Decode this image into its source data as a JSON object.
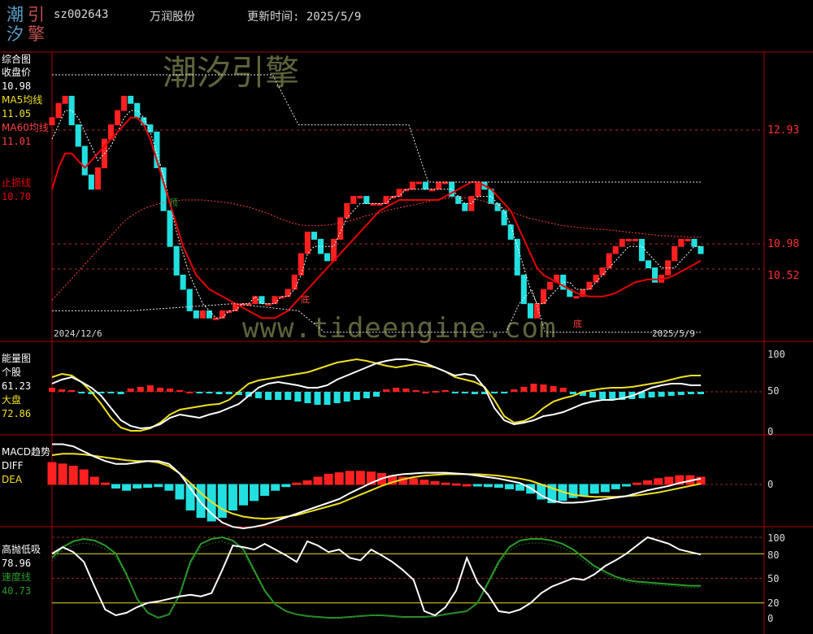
{
  "header": {
    "logo_chars": [
      "潮",
      "引",
      "汐",
      "擎"
    ],
    "stock_code": "sz002643",
    "stock_name": "万润股份",
    "update_time": "更新时间: 2025/5/9"
  },
  "watermarks": {
    "cn": "潮汐引擎",
    "url": "www.tideengine.com"
  },
  "colors": {
    "background": "#000000",
    "border": "#b00000",
    "rise": "#ff2020",
    "fall": "#22e0e0",
    "ma5": "#ffffff",
    "ma60": "#ff4040",
    "stop": "#e80000",
    "yellow": "#f0e020",
    "speed": "#2a9a2a"
  },
  "panels": {
    "main": {
      "title": "综合图",
      "close_label": "收盘价",
      "close_value": "10.98",
      "ma5_label": "MA5均线",
      "ma5_value": "11.05",
      "ma60_label": "MA60均线",
      "ma60_value": "11.01",
      "stop_label": "止损线",
      "stop_value": "10.70",
      "start_date": "2024/12/6",
      "end_date": "2025/5/9",
      "ticks": [
        "12.93",
        "10.98",
        "10.52"
      ],
      "marks": [
        "顶",
        "底",
        "底"
      ]
    },
    "energy": {
      "title": "能量图",
      "stock_label": "个股",
      "stock_value": "61.23",
      "market_label": "大盘",
      "market_value": "72.86",
      "ticks": [
        "100",
        "50",
        "0"
      ]
    },
    "macd": {
      "title": "MACD趋势",
      "diff_label": "DIFF",
      "dea_label": "DEA",
      "ticks": [
        "0"
      ]
    },
    "sell": {
      "title": "高抛低吸",
      "value": "78.96",
      "speed_label": "速度线",
      "speed_value": "40.73",
      "ticks": [
        "100",
        "80",
        "50",
        "20",
        "0"
      ]
    }
  },
  "chart_data": {
    "type": "candlestick",
    "title": "",
    "x_range": [
      "2024/12/6",
      "2025/5/9"
    ],
    "count": 100,
    "y_range": [
      10.1,
      13.6
    ],
    "close": [
      13.0,
      13.2,
      13.3,
      12.9,
      12.6,
      12.2,
      12.0,
      12.3,
      12.7,
      12.9,
      13.1,
      13.3,
      13.2,
      13.0,
      12.9,
      12.8,
      12.3,
      11.7,
      11.2,
      10.8,
      10.6,
      10.3,
      10.2,
      10.3,
      10.2,
      10.2,
      10.3,
      10.3,
      10.4,
      10.4,
      10.4,
      10.5,
      10.4,
      10.4,
      10.5,
      10.5,
      10.6,
      10.8,
      11.1,
      11.4,
      11.3,
      11.1,
      11.0,
      11.3,
      11.6,
      11.8,
      11.9,
      11.9,
      11.8,
      11.8,
      11.8,
      11.9,
      11.9,
      12.0,
      12.0,
      12.1,
      12.1,
      12.0,
      12.0,
      12.1,
      12.1,
      11.9,
      11.8,
      11.7,
      11.9,
      12.1,
      12.0,
      11.8,
      11.7,
      11.5,
      11.3,
      10.8,
      10.4,
      10.2,
      10.4,
      10.6,
      10.7,
      10.8,
      10.6,
      10.5,
      10.5,
      10.6,
      10.7,
      10.8,
      10.9,
      11.1,
      11.2,
      11.3,
      11.3,
      11.3,
      11.0,
      10.9,
      10.7,
      10.8,
      11.0,
      11.2,
      11.3,
      11.3,
      11.2,
      11.1
    ],
    "ma5": [
      12.7,
      12.9,
      13.1,
      13.1,
      13.0,
      12.8,
      12.6,
      12.4,
      12.5,
      12.6,
      12.8,
      13.0,
      13.1,
      13.1,
      13.0,
      12.8,
      12.5,
      12.2,
      11.8,
      11.4,
      11.1,
      10.8,
      10.6,
      10.4,
      10.3,
      10.2,
      10.2,
      10.3,
      10.3,
      10.4,
      10.4,
      10.5,
      10.4,
      10.4,
      10.4,
      10.5,
      10.5,
      10.6,
      10.8,
      11.1,
      11.2,
      11.2,
      11.2,
      11.2,
      11.4,
      11.6,
      11.7,
      11.8,
      11.8,
      11.8,
      11.8,
      11.8,
      11.9,
      11.9,
      12.0,
      12.0,
      12.0,
      12.0,
      12.0,
      12.0,
      12.0,
      12.0,
      11.9,
      11.8,
      11.8,
      11.9,
      11.9,
      11.9,
      11.8,
      11.7,
      11.5,
      11.2,
      10.9,
      10.6,
      10.4,
      10.4,
      10.5,
      10.6,
      10.7,
      10.7,
      10.6,
      10.6,
      10.6,
      10.7,
      10.8,
      10.9,
      11.0,
      11.1,
      11.2,
      11.2,
      11.2,
      11.1,
      11.0,
      10.9,
      10.9,
      10.9,
      11.0,
      11.1,
      11.2,
      11.2
    ],
    "ma60": [
      10.45,
      10.55,
      10.65,
      10.75,
      10.85,
      10.95,
      11.05,
      11.15,
      11.25,
      11.35,
      11.45,
      11.55,
      11.62,
      11.68,
      11.73,
      11.76,
      11.79,
      11.81,
      11.83,
      11.84,
      11.85,
      11.85,
      11.85,
      11.85,
      11.84,
      11.83,
      11.82,
      11.81,
      11.79,
      11.77,
      11.75,
      11.72,
      11.69,
      11.66,
      11.62,
      11.58,
      11.55,
      11.52,
      11.5,
      11.49,
      11.49,
      11.49,
      11.5,
      11.51,
      11.53,
      11.55,
      11.57,
      11.6,
      11.63,
      11.65,
      11.67,
      11.7,
      11.72,
      11.74,
      11.76,
      11.78,
      11.8,
      11.82,
      11.84,
      11.86,
      11.87,
      11.88,
      11.88,
      11.88,
      11.87,
      11.85,
      11.83,
      11.8,
      11.77,
      11.73,
      11.69,
      11.65,
      11.62,
      11.59,
      11.57,
      11.55,
      11.53,
      11.51,
      11.49,
      11.48,
      11.47,
      11.46,
      11.45,
      11.44,
      11.44,
      11.43,
      11.42,
      11.41,
      11.4,
      11.39,
      11.38,
      11.37,
      11.36,
      11.35,
      11.35,
      11.34,
      11.34,
      11.33,
      11.33,
      11.33
    ],
    "stop": [
      12.0,
      12.3,
      12.5,
      12.5,
      12.4,
      12.3,
      12.4,
      12.5,
      12.6,
      12.7,
      12.8,
      12.9,
      13.0,
      13.0,
      12.9,
      12.7,
      12.4,
      12.1,
      11.8,
      11.5,
      11.2,
      11.0,
      10.8,
      10.7,
      10.6,
      10.55,
      10.5,
      10.45,
      10.4,
      10.35,
      10.3,
      10.25,
      10.2,
      10.2,
      10.2,
      10.25,
      10.3,
      10.4,
      10.5,
      10.6,
      10.7,
      10.8,
      10.9,
      11.0,
      11.1,
      11.2,
      11.3,
      11.4,
      11.5,
      11.6,
      11.7,
      11.75,
      11.8,
      11.85,
      11.85,
      11.85,
      11.85,
      11.85,
      11.85,
      11.85,
      11.9,
      11.95,
      12.0,
      12.05,
      12.1,
      12.1,
      12.05,
      12.0,
      11.9,
      11.8,
      11.7,
      11.5,
      11.3,
      11.1,
      10.9,
      10.8,
      10.75,
      10.7,
      10.65,
      10.6,
      10.55,
      10.52,
      10.5,
      10.5,
      10.5,
      10.52,
      10.55,
      10.6,
      10.65,
      10.7,
      10.72,
      10.74,
      10.74,
      10.74,
      10.76,
      10.8,
      10.85,
      10.9,
      10.95,
      11.0
    ],
    "band_upper": [
      13.6,
      13.6,
      13.6,
      13.6,
      13.6,
      13.6,
      13.6,
      13.6,
      13.6,
      13.6,
      13.6,
      13.6,
      13.6,
      13.6,
      13.6,
      13.6,
      13.6,
      13.6,
      13.6,
      13.6,
      13.6,
      13.6,
      13.6,
      13.6,
      13.6,
      13.6,
      13.6,
      13.6,
      13.6,
      13.6,
      13.6,
      13.6,
      13.6,
      13.6,
      13.6,
      13.6,
      13.6,
      13.6,
      13.6,
      13.6,
      13.6,
      13.6,
      13.6,
      13.6,
      13.6,
      13.6,
      13.6,
      13.6,
      13.6,
      13.6,
      13.6,
      13.6,
      13.6,
      13.6,
      13.6,
      13.6,
      13.6,
      13.6,
      13.6,
      13.6,
      13.6,
      13.6,
      13.6,
      13.6,
      13.6,
      13.6,
      13.6,
      13.6,
      13.6,
      13.6,
      13.6,
      13.6,
      13.6,
      13.6,
      13.6,
      13.6,
      13.6,
      13.6,
      13.6,
      13.6,
      13.6,
      13.6,
      13.6,
      13.6,
      13.6,
      13.6,
      13.6,
      13.6,
      13.6,
      13.6,
      13.6,
      13.6,
      13.6,
      13.6,
      13.6,
      13.6,
      13.6,
      13.6,
      13.6,
      13.6
    ],
    "upper_levels": [
      [
        0,
        13.6
      ],
      [
        34,
        13.6
      ],
      [
        38,
        12.9
      ],
      [
        55,
        12.9
      ],
      [
        58,
        12.1
      ],
      [
        80,
        12.1
      ],
      [
        88,
        12.1
      ],
      [
        90,
        12.1
      ],
      [
        100,
        12.1
      ]
    ],
    "lower_levels": [
      [
        0,
        10.3
      ],
      [
        12,
        10.3
      ],
      [
        28,
        10.4
      ],
      [
        38,
        10.3
      ],
      [
        42,
        10.0
      ],
      [
        70,
        10.0
      ],
      [
        72,
        10.4
      ],
      [
        74,
        10.6
      ],
      [
        76,
        10.0
      ],
      [
        100,
        10.0
      ]
    ],
    "energy_stock": [
      60,
      65,
      68,
      62,
      55,
      45,
      30,
      15,
      8,
      5,
      6,
      10,
      18,
      22,
      20,
      18,
      22,
      25,
      30,
      35,
      45,
      55,
      60,
      62,
      60,
      58,
      55,
      55,
      58,
      65,
      70,
      75,
      80,
      85,
      88,
      90,
      90,
      88,
      85,
      80,
      75,
      70,
      72,
      70,
      55,
      30,
      15,
      10,
      12,
      15,
      20,
      22,
      25,
      30,
      35,
      38,
      40,
      40,
      42,
      45,
      50,
      55,
      58,
      60,
      60,
      58,
      58
    ],
    "energy_market": [
      68,
      72,
      70,
      62,
      50,
      35,
      18,
      6,
      2,
      2,
      5,
      12,
      22,
      28,
      30,
      32,
      34,
      35,
      40,
      50,
      60,
      64,
      66,
      68,
      70,
      72,
      74,
      78,
      82,
      86,
      88,
      90,
      88,
      85,
      82,
      80,
      82,
      84,
      82,
      80,
      75,
      68,
      65,
      62,
      56,
      40,
      20,
      12,
      14,
      20,
      30,
      38,
      42,
      45,
      50,
      52,
      54,
      55,
      55,
      56,
      58,
      60,
      62,
      65,
      68,
      70,
      70
    ],
    "energy_bars": [
      5,
      3,
      2,
      -1,
      -3,
      -2,
      -2,
      -3,
      4,
      6,
      8,
      5,
      4,
      2,
      0,
      -1,
      -2,
      -3,
      -3,
      -4,
      -6,
      -8,
      -10,
      -10,
      -10,
      -12,
      -14,
      -16,
      -16,
      -14,
      -12,
      -10,
      -8,
      -6,
      3,
      5,
      4,
      2,
      0,
      1,
      2,
      -1,
      -2,
      -3,
      -3,
      -2,
      -1,
      3,
      6,
      10,
      9,
      7,
      5,
      -3,
      -5,
      -7,
      -9,
      -10,
      -10,
      -9,
      -8,
      -7,
      -6,
      -5,
      -4,
      -3,
      -3
    ],
    "macd_diff": [
      0.55,
      0.55,
      0.52,
      0.45,
      0.38,
      0.32,
      0.28,
      0.28,
      0.3,
      0.32,
      0.32,
      0.28,
      0.15,
      -0.05,
      -0.25,
      -0.4,
      -0.52,
      -0.58,
      -0.6,
      -0.58,
      -0.55,
      -0.5,
      -0.45,
      -0.4,
      -0.35,
      -0.3,
      -0.25,
      -0.2,
      -0.12,
      -0.05,
      0.02,
      0.08,
      0.12,
      0.14,
      0.15,
      0.16,
      0.16,
      0.16,
      0.15,
      0.14,
      0.12,
      0.1,
      0.08,
      0.05,
      0.02,
      -0.05,
      -0.15,
      -0.22,
      -0.25,
      -0.25,
      -0.24,
      -0.22,
      -0.2,
      -0.18,
      -0.16,
      -0.12,
      -0.08,
      -0.05,
      -0.02,
      0.02,
      0.05,
      0.08
    ],
    "macd_dea": [
      0.4,
      0.42,
      0.42,
      0.41,
      0.39,
      0.37,
      0.35,
      0.33,
      0.32,
      0.32,
      0.3,
      0.25,
      0.15,
      0.02,
      -0.12,
      -0.24,
      -0.34,
      -0.4,
      -0.44,
      -0.46,
      -0.47,
      -0.46,
      -0.44,
      -0.42,
      -0.38,
      -0.34,
      -0.3,
      -0.26,
      -0.2,
      -0.14,
      -0.08,
      -0.02,
      0.03,
      0.07,
      0.1,
      0.12,
      0.13,
      0.14,
      0.14,
      0.14,
      0.14,
      0.13,
      0.12,
      0.1,
      0.08,
      0.05,
      0.0,
      -0.05,
      -0.1,
      -0.14,
      -0.16,
      -0.17,
      -0.17,
      -0.17,
      -0.16,
      -0.15,
      -0.13,
      -0.11,
      -0.08,
      -0.05,
      -0.02,
      0.01
    ],
    "macd_bars": [
      0.3,
      0.28,
      0.25,
      0.2,
      0.1,
      0.02,
      -0.05,
      -0.08,
      -0.05,
      -0.04,
      -0.03,
      -0.08,
      -0.2,
      -0.35,
      -0.45,
      -0.5,
      -0.45,
      -0.35,
      -0.28,
      -0.22,
      -0.15,
      -0.08,
      -0.03,
      0.02,
      0.05,
      0.1,
      0.14,
      0.16,
      0.18,
      0.18,
      0.17,
      0.15,
      0.12,
      0.1,
      0.08,
      0.06,
      0.04,
      0.02,
      0.01,
      0.0,
      -0.02,
      -0.03,
      -0.04,
      -0.06,
      -0.08,
      -0.12,
      -0.2,
      -0.25,
      -0.22,
      -0.18,
      -0.15,
      -0.12,
      -0.1,
      -0.06,
      -0.02,
      0.02,
      0.05,
      0.08,
      0.1,
      0.12,
      0.12,
      0.1
    ],
    "sell_value": [
      80,
      88,
      82,
      70,
      40,
      12,
      5,
      8,
      15,
      20,
      22,
      25,
      28,
      30,
      28,
      32,
      60,
      90,
      88,
      85,
      92,
      85,
      78,
      70,
      95,
      90,
      82,
      85,
      75,
      72,
      85,
      78,
      70,
      60,
      48,
      10,
      5,
      15,
      35,
      75,
      45,
      30,
      10,
      8,
      12,
      20,
      32,
      40,
      45,
      50,
      48,
      55,
      65,
      72,
      80,
      90,
      100,
      96,
      92,
      85,
      82,
      79
    ],
    "speed_value": [
      75,
      88,
      95,
      98,
      96,
      90,
      80,
      55,
      25,
      8,
      2,
      6,
      30,
      70,
      92,
      98,
      100,
      96,
      85,
      60,
      35,
      18,
      10,
      6,
      4,
      3,
      2,
      2,
      3,
      4,
      5,
      5,
      4,
      3,
      3,
      3,
      4,
      6,
      8,
      10,
      20,
      45,
      70,
      88,
      96,
      98,
      98,
      96,
      92,
      85,
      75,
      65,
      58,
      52,
      48,
      46,
      45,
      44,
      43,
      42,
      41,
      41
    ]
  }
}
